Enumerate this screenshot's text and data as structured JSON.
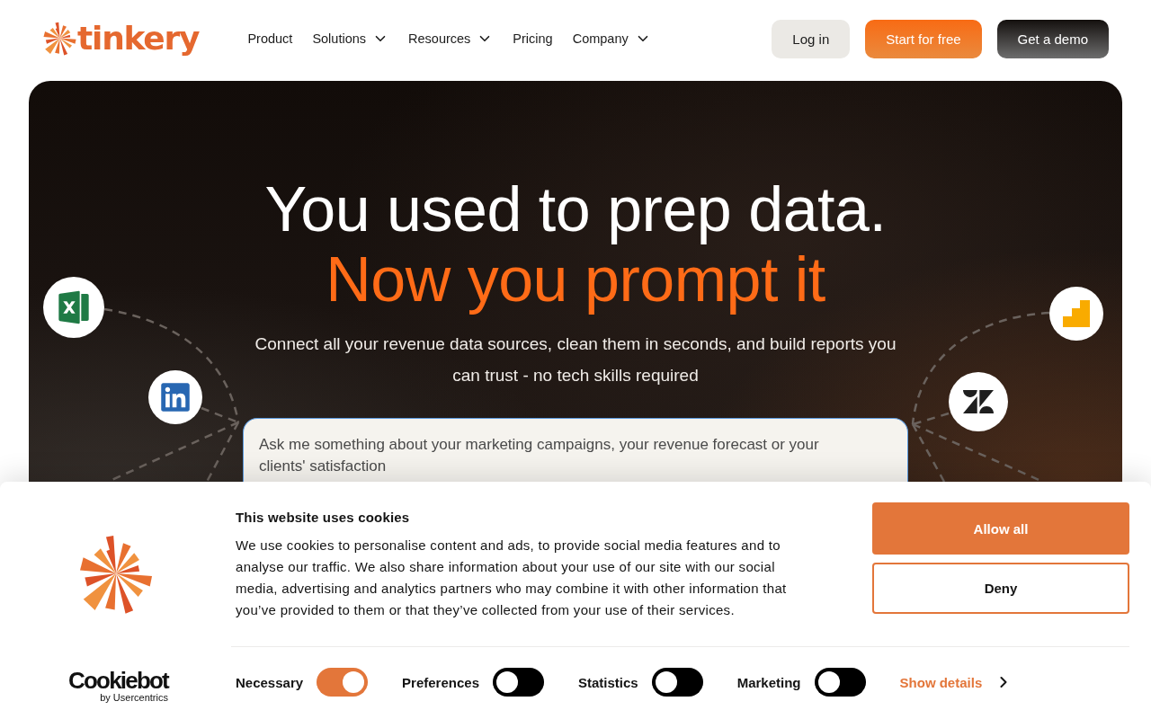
{
  "header": {
    "logo": {
      "wordmark": "tinkery"
    },
    "nav": [
      {
        "label": "Product",
        "has_menu": false
      },
      {
        "label": "Solutions",
        "has_menu": true
      },
      {
        "label": "Resources",
        "has_menu": true
      },
      {
        "label": "Pricing",
        "has_menu": false
      },
      {
        "label": "Company",
        "has_menu": true
      }
    ],
    "actions": [
      {
        "label": "Log in",
        "kind": "secondary"
      },
      {
        "label": "Start for free",
        "kind": "primary"
      },
      {
        "label": "Get a demo",
        "kind": "dark"
      }
    ]
  },
  "hero": {
    "headline": "You used to prep data.",
    "headline_accent": "Now you prompt it",
    "subtitle": "Connect all your revenue data sources, clean them in seconds, and build reports you can trust - no tech skills required",
    "prompt": {
      "placeholder": "Ask me something about your marketing campaigns, your revenue forecast or your clients' satisfaction"
    }
  },
  "cookie_banner": {
    "branding": {
      "name": "Cookiebot",
      "byline": "by Usercentrics"
    },
    "title": "This website uses cookies",
    "body": "We use cookies to personalise content and ads, to provide social media features and to analyse our traffic. We also share information about your use of our site with our social media, advertising and analytics partners who may combine it with other information that you’ve provided to them or that they’ve collected from your use of their services.",
    "buttons": [
      {
        "label": "Allow all",
        "kind": "primary"
      },
      {
        "label": "Deny",
        "kind": "outline"
      }
    ],
    "toggles": [
      {
        "label": "Necessary",
        "on": true
      },
      {
        "label": "Preferences",
        "on": false
      },
      {
        "label": "Statistics",
        "on": false
      },
      {
        "label": "Marketing",
        "on": false
      }
    ],
    "details_link": "Show details"
  }
}
